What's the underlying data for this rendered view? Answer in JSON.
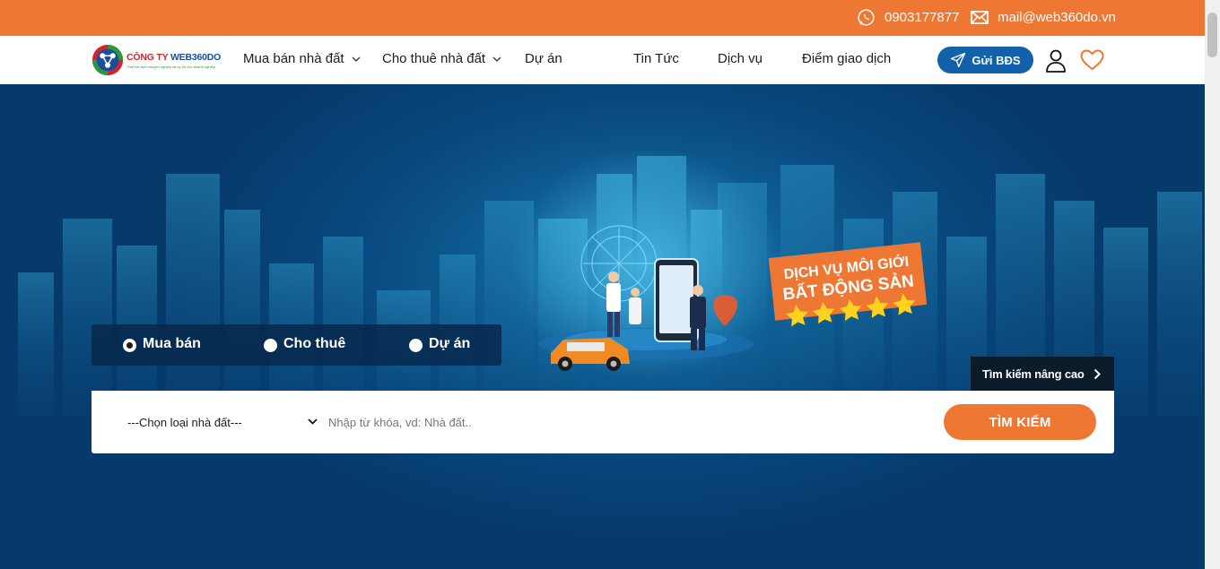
{
  "topbar": {
    "phone": "0903177877",
    "email": "mail@web360do.vn",
    "icons": {
      "phone": "whatsapp-phone-icon",
      "email": "envelope-icon"
    }
  },
  "logo": {
    "brand_prefix": "CÔNG TY ",
    "brand_name": "WEB360DO",
    "tagline": "Thiết kế web chuyên nghiệp và uy tín cho doanh nghiệp"
  },
  "nav": {
    "items": [
      {
        "label": "Mua bán nhà đất",
        "dropdown": true
      },
      {
        "label": "Cho thuê nhà đất",
        "dropdown": true
      },
      {
        "label": "Dự án",
        "dropdown": false
      },
      {
        "label": "Tin Tức",
        "dropdown": false
      },
      {
        "label": "Dịch vụ",
        "dropdown": false
      },
      {
        "label": "Điểm giao dịch",
        "dropdown": false
      }
    ],
    "post_button": "Gửi BĐS"
  },
  "hero": {
    "banner_line1": "DỊCH VỤ MÔI GIỚI",
    "banner_line2": "BẤT ĐỘNG SẢN",
    "stars": 5
  },
  "search": {
    "tabs": [
      {
        "label": "Mua bán",
        "selected": true
      },
      {
        "label": "Cho thuê",
        "selected": false
      },
      {
        "label": "Dự án",
        "selected": false
      }
    ],
    "advanced_label": "Tìm kiếm nâng cao",
    "type_select": "---Chọn loại nhà đất---",
    "keyword_placeholder": "Nhập từ khóa, vd: Nhà đất..",
    "keyword_value": "",
    "submit_label": "TÌM KIẾM"
  },
  "colors": {
    "accent_orange": "#ee7733",
    "primary_blue": "#1360ab",
    "hero_navy": "#063a6b"
  }
}
